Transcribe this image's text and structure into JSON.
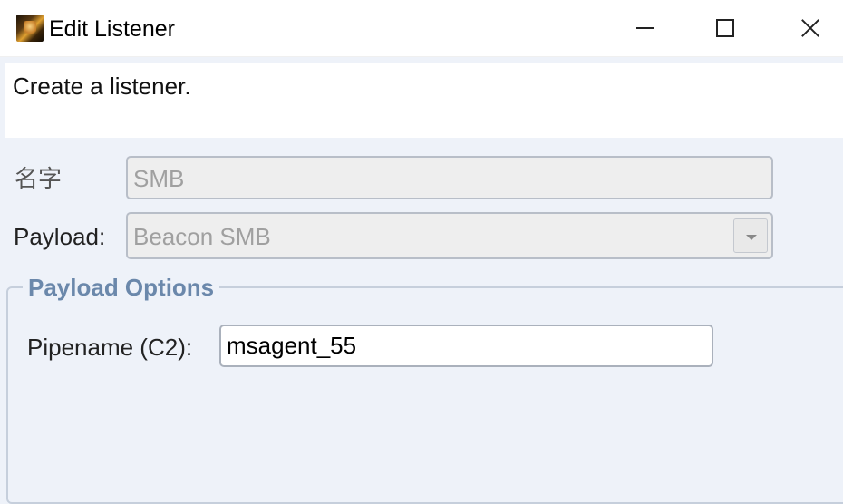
{
  "window": {
    "title": "Edit Listener",
    "icon": "cobalt-strike-app-icon",
    "controls": [
      "minimize",
      "maximize",
      "close"
    ]
  },
  "description": "Create a listener.",
  "form": {
    "name_label": "名字",
    "name_value": "SMB",
    "payload_label": "Payload:",
    "payload_value": "Beacon SMB"
  },
  "options": {
    "legend": "Payload Options",
    "pipename_label": "Pipename (C2):",
    "pipename_value": "msagent_55"
  },
  "colors": {
    "background": "#eef2f9",
    "legend_text": "#6b88ab",
    "disabled_text": "#a0a0a0"
  }
}
